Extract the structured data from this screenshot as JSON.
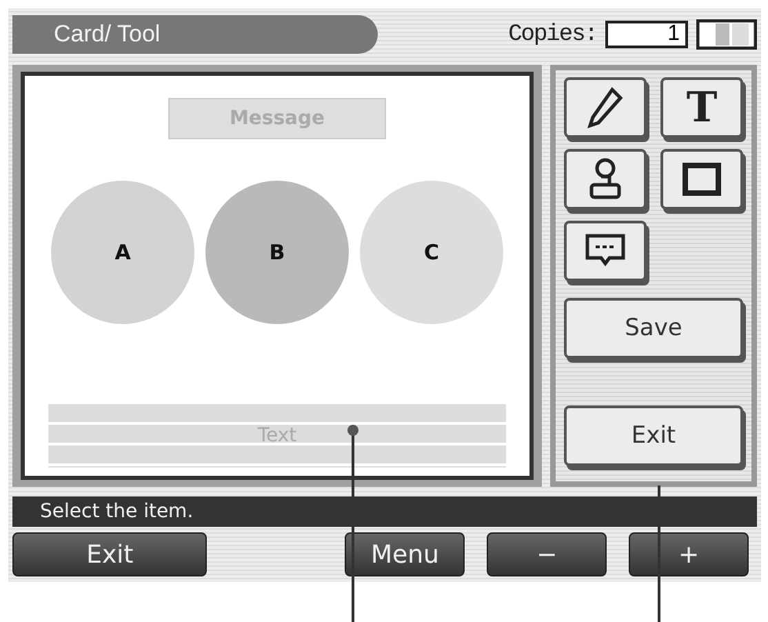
{
  "title_bar": {
    "title": "Card/ Tool",
    "copies_label": "Copies:",
    "copies_value": "1"
  },
  "card": {
    "message": "Message",
    "text": "Text",
    "circles": [
      {
        "label": "A",
        "color": "#d3d3d3"
      },
      {
        "label": "B",
        "color": "#b9b9b9"
      },
      {
        "label": "C",
        "color": "#dddddd"
      }
    ]
  },
  "tools": [
    {
      "kind": "pencil"
    },
    {
      "kind": "letter",
      "label": "T"
    },
    {
      "kind": "stamp"
    },
    {
      "kind": "frame"
    },
    {
      "kind": "message"
    }
  ],
  "tool_actions": [
    "Save",
    "Exit"
  ],
  "status_bar": "Select the item.",
  "buttons": [
    {
      "label": "Exit",
      "kind": "wide"
    },
    {
      "label": "Menu",
      "kind": "normal"
    },
    {
      "label": "−",
      "kind": "normal"
    },
    {
      "label": "+",
      "kind": "normal"
    }
  ]
}
